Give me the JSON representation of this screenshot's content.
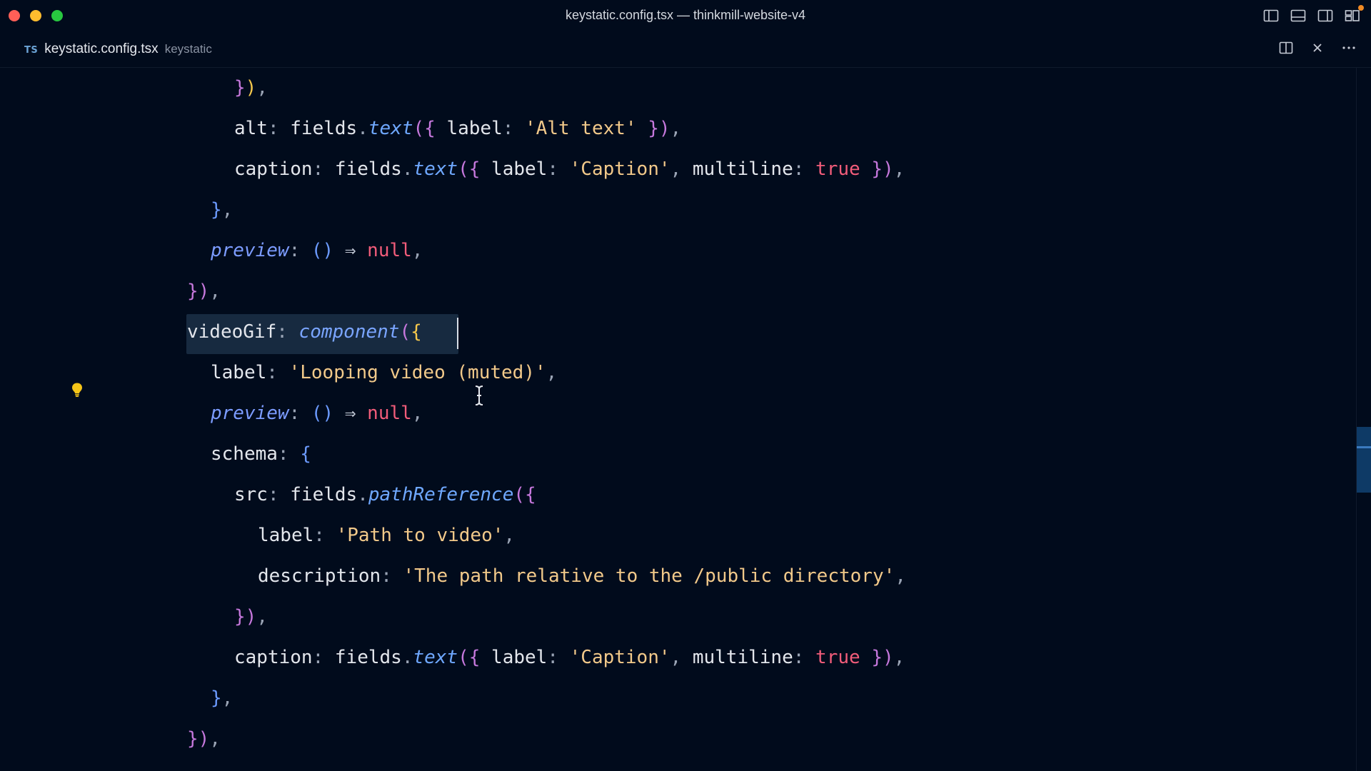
{
  "window": {
    "title": "keystatic.config.tsx — thinkmill-website-v4"
  },
  "tab": {
    "language_badge": "TS",
    "filename": "keystatic.config.tsx",
    "folder": "keystatic"
  },
  "icons": {
    "layout": [
      "toggle-primary-sidebar-icon",
      "toggle-panel-icon",
      "toggle-secondary-sidebar-icon",
      "customize-layout-icon"
    ],
    "tab_actions": [
      "split-editor-icon",
      "close-icon",
      "more-actions-icon"
    ],
    "gutter": "lightbulb-icon",
    "pointer": "text-cursor-icon"
  },
  "colors": {
    "background": "#010b1c",
    "string": "#f2c98a",
    "function": "#6fa8ff",
    "boolean": "#f25c7a",
    "line_highlight": "#172a40",
    "lightbulb": "#f5c518",
    "notify": "#f08a24"
  },
  "code": {
    "lines": [
      {
        "indent": 4,
        "tokens": [
          {
            "t": "}",
            "c": "t-b1"
          },
          {
            "t": ")",
            "c": "t-b3"
          },
          {
            "t": ",",
            "c": "t-punc"
          }
        ]
      },
      {
        "indent": 4,
        "tokens": [
          {
            "t": "alt",
            "c": "t-prop"
          },
          {
            "t": ": ",
            "c": "t-punc"
          },
          {
            "t": "fields",
            "c": "t-prop"
          },
          {
            "t": ".",
            "c": "t-punc"
          },
          {
            "t": "text",
            "c": "t-fn"
          },
          {
            "t": "(",
            "c": "t-b1"
          },
          {
            "t": "{",
            "c": "t-b1"
          },
          {
            "t": " label",
            "c": "t-prop"
          },
          {
            "t": ": ",
            "c": "t-punc"
          },
          {
            "t": "'Alt text'",
            "c": "t-str"
          },
          {
            "t": " ",
            "c": "t-punc"
          },
          {
            "t": "}",
            "c": "t-b1"
          },
          {
            "t": ")",
            "c": "t-b1"
          },
          {
            "t": ",",
            "c": "t-punc"
          }
        ]
      },
      {
        "indent": 4,
        "tokens": [
          {
            "t": "caption",
            "c": "t-prop"
          },
          {
            "t": ": ",
            "c": "t-punc"
          },
          {
            "t": "fields",
            "c": "t-prop"
          },
          {
            "t": ".",
            "c": "t-punc"
          },
          {
            "t": "text",
            "c": "t-fn"
          },
          {
            "t": "(",
            "c": "t-b1"
          },
          {
            "t": "{",
            "c": "t-b1"
          },
          {
            "t": " label",
            "c": "t-prop"
          },
          {
            "t": ": ",
            "c": "t-punc"
          },
          {
            "t": "'Caption'",
            "c": "t-str"
          },
          {
            "t": ", ",
            "c": "t-punc"
          },
          {
            "t": "multiline",
            "c": "t-prop"
          },
          {
            "t": ": ",
            "c": "t-punc"
          },
          {
            "t": "true",
            "c": "t-bool"
          },
          {
            "t": " ",
            "c": "t-punc"
          },
          {
            "t": "}",
            "c": "t-b1"
          },
          {
            "t": ")",
            "c": "t-b1"
          },
          {
            "t": ",",
            "c": "t-punc"
          }
        ]
      },
      {
        "indent": 3,
        "tokens": [
          {
            "t": "}",
            "c": "t-b2"
          },
          {
            "t": ",",
            "c": "t-punc"
          }
        ]
      },
      {
        "indent": 3,
        "tokens": [
          {
            "t": "preview",
            "c": "t-key"
          },
          {
            "t": ": ",
            "c": "t-punc"
          },
          {
            "t": "()",
            "c": "t-b2"
          },
          {
            "t": " ⇒ ",
            "c": "t-arrow"
          },
          {
            "t": "null",
            "c": "t-bool"
          },
          {
            "t": ",",
            "c": "t-punc"
          }
        ]
      },
      {
        "indent": 2,
        "tokens": [
          {
            "t": "}",
            "c": "t-b1"
          },
          {
            "t": ")",
            "c": "t-b1"
          },
          {
            "t": ",",
            "c": "t-punc"
          }
        ]
      },
      {
        "indent": 2,
        "tokens": [
          {
            "t": "videoGif",
            "c": "t-prop"
          },
          {
            "t": ": ",
            "c": "t-punc"
          },
          {
            "t": "component",
            "c": "t-fnn"
          },
          {
            "t": "(",
            "c": "t-b1"
          },
          {
            "t": "{",
            "c": "t-b3"
          }
        ]
      },
      {
        "indent": 3,
        "tokens": [
          {
            "t": "label",
            "c": "t-prop"
          },
          {
            "t": ": ",
            "c": "t-punc"
          },
          {
            "t": "'Looping video (muted)'",
            "c": "t-str"
          },
          {
            "t": ",",
            "c": "t-punc"
          }
        ]
      },
      {
        "indent": 3,
        "tokens": [
          {
            "t": "preview",
            "c": "t-key"
          },
          {
            "t": ": ",
            "c": "t-punc"
          },
          {
            "t": "()",
            "c": "t-b2"
          },
          {
            "t": " ⇒ ",
            "c": "t-arrow"
          },
          {
            "t": "null",
            "c": "t-bool"
          },
          {
            "t": ",",
            "c": "t-punc"
          }
        ]
      },
      {
        "indent": 3,
        "tokens": [
          {
            "t": "schema",
            "c": "t-prop"
          },
          {
            "t": ": ",
            "c": "t-punc"
          },
          {
            "t": "{",
            "c": "t-b2"
          }
        ]
      },
      {
        "indent": 4,
        "tokens": [
          {
            "t": "src",
            "c": "t-prop"
          },
          {
            "t": ": ",
            "c": "t-punc"
          },
          {
            "t": "fields",
            "c": "t-prop"
          },
          {
            "t": ".",
            "c": "t-punc"
          },
          {
            "t": "pathReference",
            "c": "t-fn"
          },
          {
            "t": "(",
            "c": "t-b1"
          },
          {
            "t": "{",
            "c": "t-b1"
          }
        ]
      },
      {
        "indent": 5,
        "tokens": [
          {
            "t": "label",
            "c": "t-prop"
          },
          {
            "t": ": ",
            "c": "t-punc"
          },
          {
            "t": "'Path to video'",
            "c": "t-str"
          },
          {
            "t": ",",
            "c": "t-punc"
          }
        ]
      },
      {
        "indent": 5,
        "tokens": [
          {
            "t": "description",
            "c": "t-prop"
          },
          {
            "t": ": ",
            "c": "t-punc"
          },
          {
            "t": "'The path relative to the /public directory'",
            "c": "t-str"
          },
          {
            "t": ",",
            "c": "t-punc"
          }
        ]
      },
      {
        "indent": 4,
        "tokens": [
          {
            "t": "}",
            "c": "t-b1"
          },
          {
            "t": ")",
            "c": "t-b1"
          },
          {
            "t": ",",
            "c": "t-punc"
          }
        ]
      },
      {
        "indent": 4,
        "tokens": [
          {
            "t": "caption",
            "c": "t-prop"
          },
          {
            "t": ": ",
            "c": "t-punc"
          },
          {
            "t": "fields",
            "c": "t-prop"
          },
          {
            "t": ".",
            "c": "t-punc"
          },
          {
            "t": "text",
            "c": "t-fn"
          },
          {
            "t": "(",
            "c": "t-b1"
          },
          {
            "t": "{",
            "c": "t-b1"
          },
          {
            "t": " label",
            "c": "t-prop"
          },
          {
            "t": ": ",
            "c": "t-punc"
          },
          {
            "t": "'Caption'",
            "c": "t-str"
          },
          {
            "t": ", ",
            "c": "t-punc"
          },
          {
            "t": "multiline",
            "c": "t-prop"
          },
          {
            "t": ": ",
            "c": "t-punc"
          },
          {
            "t": "true",
            "c": "t-bool"
          },
          {
            "t": " ",
            "c": "t-punc"
          },
          {
            "t": "}",
            "c": "t-b1"
          },
          {
            "t": ")",
            "c": "t-b1"
          },
          {
            "t": ",",
            "c": "t-punc"
          }
        ]
      },
      {
        "indent": 3,
        "tokens": [
          {
            "t": "}",
            "c": "t-b2"
          },
          {
            "t": ",",
            "c": "t-punc"
          }
        ]
      },
      {
        "indent": 2,
        "tokens": [
          {
            "t": "}",
            "c": "t-b1"
          },
          {
            "t": ")",
            "c": "t-b1"
          },
          {
            "t": ",",
            "c": "t-punc"
          }
        ]
      }
    ]
  }
}
